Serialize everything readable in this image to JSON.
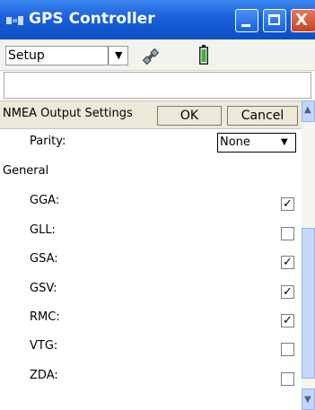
{
  "window": {
    "title": "GPS Controller",
    "minimize_label": "_",
    "maximize_label": "□",
    "close_label": "X",
    "title_bar_color": "#1a5fd8"
  },
  "toolbar": {
    "mode_select_value": "Setup",
    "mode_select_arrow": "▼",
    "satellite_icon": "satellite-icon",
    "battery_icon": "battery-icon"
  },
  "settings": {
    "section_title": "NMEA Output Settings",
    "ok_label": "OK",
    "cancel_label": "Cancel",
    "parity": {
      "label": "Parity:",
      "value": "None",
      "arrow": "▼"
    },
    "general_heading": "General",
    "sentences": [
      {
        "label": "GGA:",
        "checked": true,
        "mark": "✓"
      },
      {
        "label": "GLL:",
        "checked": false,
        "mark": ""
      },
      {
        "label": "GSA:",
        "checked": true,
        "mark": "✓"
      },
      {
        "label": "GSV:",
        "checked": true,
        "mark": "✓"
      },
      {
        "label": "RMC:",
        "checked": true,
        "mark": "✓"
      },
      {
        "label": "VTG:",
        "checked": false,
        "mark": ""
      },
      {
        "label": "ZDA:",
        "checked": false,
        "mark": ""
      }
    ]
  },
  "scrollbar": {
    "up_arrow": "▲",
    "down_arrow": "▼"
  }
}
